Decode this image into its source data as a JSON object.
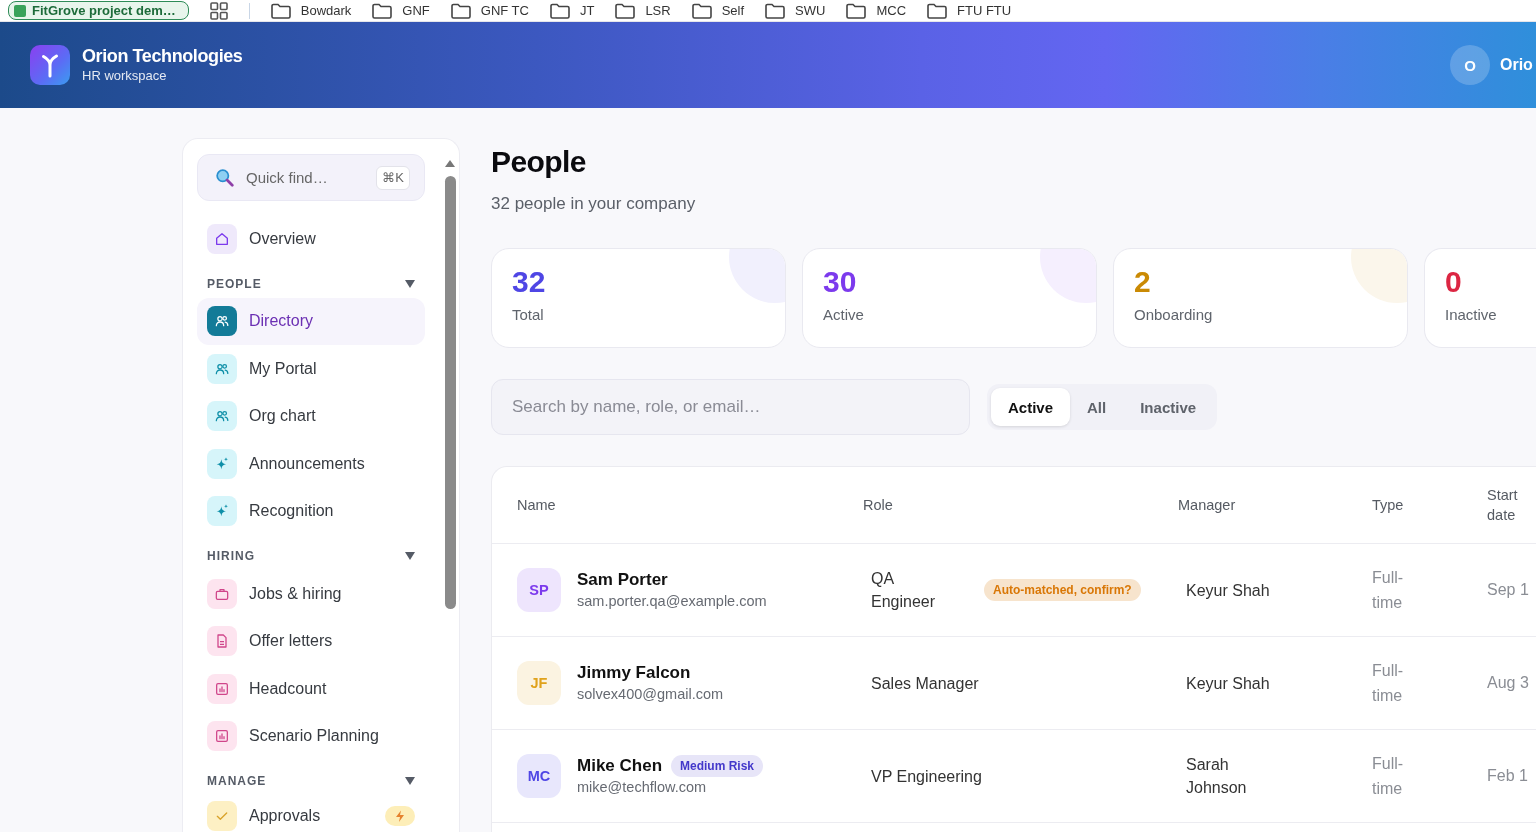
{
  "bookmarks_bar": {
    "tab_group": "FitGrove project dem…",
    "folders": [
      "Bowdark",
      "GNF",
      "GNF TC",
      "JT",
      "LSR",
      "Self",
      "SWU",
      "MCC",
      "FTU FTU"
    ]
  },
  "app_header": {
    "title": "Orion Technologies",
    "subtitle": "HR workspace",
    "user_initial": "O",
    "user_name": "Orio"
  },
  "sidebar": {
    "search": {
      "placeholder": "Quick find…",
      "shortcut": "⌘K"
    },
    "top_items": [
      {
        "label": "Overview",
        "selected": false,
        "alert": false
      }
    ],
    "sections": [
      {
        "title": "PEOPLE",
        "expanded": true,
        "items": [
          {
            "label": "Directory",
            "selected": true,
            "alert": false
          },
          {
            "label": "My Portal",
            "selected": false,
            "alert": false
          },
          {
            "label": "Org chart",
            "selected": false,
            "alert": false
          },
          {
            "label": "Announcements",
            "selected": false,
            "alert": false
          },
          {
            "label": "Recognition",
            "selected": false,
            "alert": false
          }
        ]
      },
      {
        "title": "HIRING",
        "expanded": true,
        "items": [
          {
            "label": "Jobs & hiring",
            "selected": false,
            "alert": false
          },
          {
            "label": "Offer letters",
            "selected": false,
            "alert": false
          },
          {
            "label": "Headcount",
            "selected": false,
            "alert": false
          },
          {
            "label": "Scenario Planning",
            "selected": false,
            "alert": false
          }
        ]
      },
      {
        "title": "MANAGE",
        "expanded": true,
        "items": [
          {
            "label": "Approvals",
            "selected": false,
            "alert": true
          }
        ]
      }
    ]
  },
  "page": {
    "title": "People",
    "subtitle": "32 people in your company"
  },
  "stats": [
    {
      "value": "32",
      "label": "Total",
      "color": "#4f46e5"
    },
    {
      "value": "30",
      "label": "Active",
      "color": "#7c3aed"
    },
    {
      "value": "2",
      "label": "Onboarding",
      "color": "#ca8a04"
    },
    {
      "value": "0",
      "label": "Inactive",
      "color": "#dc2643"
    }
  ],
  "search": {
    "placeholder": "Search by name, role, or email…"
  },
  "filters": [
    {
      "label": "Active",
      "selected": true
    },
    {
      "label": "All",
      "selected": false
    },
    {
      "label": "Inactive",
      "selected": false
    }
  ],
  "table": {
    "columns": [
      "Name",
      "Role",
      "Manager",
      "Type",
      "Start date"
    ],
    "rows": [
      {
        "initials": "SP",
        "color": "#7c3aed",
        "name": "Sam Porter",
        "email": "sam.porter.qa@example.com",
        "role": "QA Engineer",
        "role_badge": {
          "text": "Auto-matched, confirm?",
          "color": "#d97706"
        },
        "manager": "Keyur Shah",
        "type": "Full-time",
        "start_date": "Sep 1"
      },
      {
        "initials": "JF",
        "color": "#e0a21c",
        "name": "Jimmy Falcon",
        "email": "solvex400@gmail.com",
        "role": "Sales Manager",
        "manager": "Keyur Shah",
        "type": "Full-time",
        "start_date": "Aug 3"
      },
      {
        "initials": "MC",
        "color": "#4f46e5",
        "name": "Mike Chen",
        "name_badge": {
          "text": "Medium Risk",
          "color": "#4338ca"
        },
        "email": "mike@techflow.com",
        "role": "VP Engineering",
        "manager": "Sarah Johnson",
        "type": "Full-time",
        "start_date": "Feb 1"
      }
    ]
  }
}
